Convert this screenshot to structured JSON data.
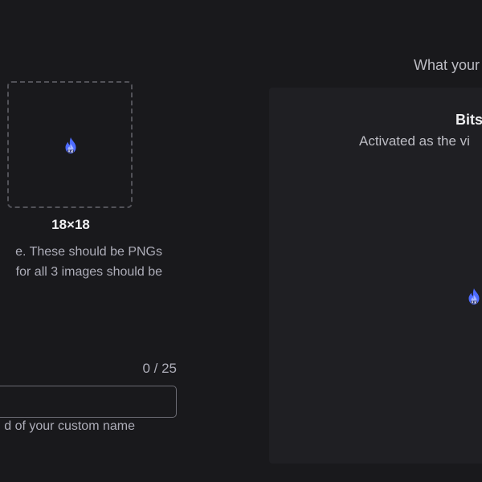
{
  "preview": {
    "heading": "What your",
    "card_title": "Bits",
    "card_subtitle": "Activated as the vi"
  },
  "upload": {
    "size_label": "18×18",
    "icon": "bits-flame-icon",
    "icon_color": "#4d6bff"
  },
  "help_text": {
    "line1": "e. These should be PNGs",
    "line2": "for all 3 images should be"
  },
  "name_field": {
    "counter": "0 / 25",
    "value": "",
    "placeholder": "",
    "hint": "d of your custom name"
  }
}
